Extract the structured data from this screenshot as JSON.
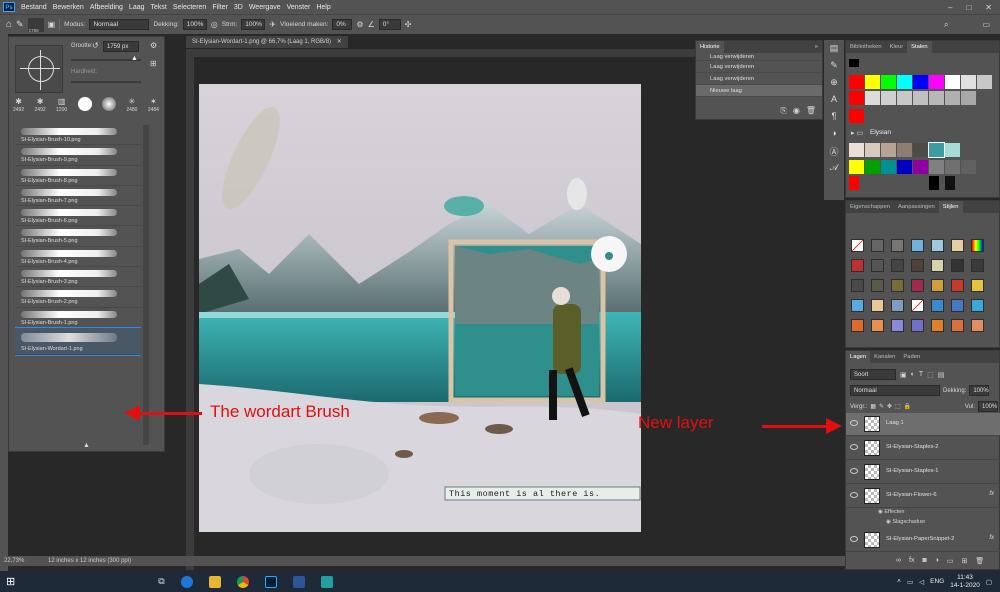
{
  "menubar": {
    "items": [
      "Bestand",
      "Bewerken",
      "Afbeelding",
      "Laag",
      "Tekst",
      "Selecteren",
      "Filter",
      "3D",
      "Weergave",
      "Venster",
      "Help"
    ]
  },
  "options": {
    "brush_size": "1759",
    "mode_label": "Modus:",
    "mode_value": "Normaal",
    "opacity_label": "Dekking:",
    "opacity_value": "100%",
    "flow_label": "Strm:",
    "flow_value": "100%",
    "smoothing_label": "Vloeiend maken:",
    "smoothing_value": "0%",
    "angle_value": "0°"
  },
  "brush_panel": {
    "size_label": "Grootte:",
    "size_value": "1759 px",
    "hardness_label": "Hardheid:",
    "presets": [
      "2492",
      "2492",
      "1200",
      "",
      "2480",
      "2484"
    ],
    "brushes": [
      "SI-Elysian-Brush-10.png",
      "SI-Elysian-Brush-9.png",
      "SI-Elysian-Brush-8.png",
      "SI-Elysian-Brush-7.png",
      "SI-Elysian-Brush-6.png",
      "SI-Elysian-Brush-5.png",
      "SI-Elysian-Brush-4.png",
      "SI-Elysian-Brush-3.png",
      "SI-Elysian-Brush-2.png",
      "SI-Elysian-Brush-1.png",
      "SI-Elysian-Wordart-1.png"
    ]
  },
  "document": {
    "tab_title": "SI-Elysian-Wordart-1.png @ 66,7% (Laag 1, RGB/8)",
    "canvas_caption": "This moment is al there is."
  },
  "history": {
    "title": "Historie",
    "items": [
      "Laag verwijderen",
      "Laag verwijderen",
      "Laag verwijderen",
      "Nieuwe laag"
    ]
  },
  "swatches_panel": {
    "tabs": [
      "Bibliotheken",
      "Kleur",
      "Stalen"
    ],
    "group_name": "Elysian",
    "colors": [
      "#000000",
      "#ffffff",
      "#ffff00",
      "#00ff00",
      "#00ffff",
      "#0000ff",
      "#ff00ff",
      "#ff0000",
      "#c0c0c0",
      "#808080"
    ]
  },
  "styles_panel": {
    "tabs": [
      "Eigenschappen",
      "Aanpassingen",
      "Stijlen"
    ]
  },
  "layers_panel": {
    "tabs": [
      "Lagen",
      "Kanalen",
      "Paden"
    ],
    "filter": "Soort",
    "blend": "Normaal",
    "opacity_label": "Dekking:",
    "opacity_value": "100%",
    "lock_label": "Vergr.:",
    "fill_label": "Vul:",
    "fill_value": "100%",
    "layers": [
      {
        "name": "Laag 1",
        "fx": ""
      },
      {
        "name": "SI-Elysian-Staples-2",
        "fx": ""
      },
      {
        "name": "SI-Elysian-Staples-1",
        "fx": ""
      },
      {
        "name": "SI-Elysian-Flower-6",
        "fx": "fx"
      },
      {
        "name": "SI-Elysian-PaperSnippet-2",
        "fx": "fx"
      }
    ],
    "effects_label": "Effecten",
    "drop_shadow_label": "Slagschaduw"
  },
  "statusbar": {
    "zoom": "22,73%",
    "doc_info": "12 inches x 12 inches (300 ppi)"
  },
  "taskbar": {
    "lang": "ENG",
    "time": "11:43",
    "date": "14-1-2020"
  },
  "annotations": {
    "brush_note": "The wordart Brush",
    "layer_note": "New layer"
  }
}
